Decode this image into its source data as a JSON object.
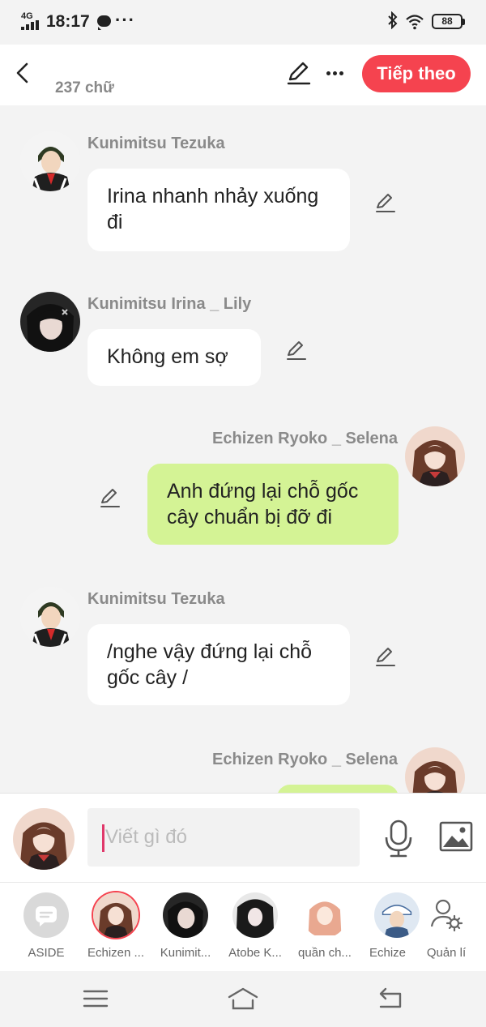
{
  "status_bar": {
    "network": "4G",
    "time": "18:17",
    "battery": "88"
  },
  "header": {
    "word_count": "237 chữ",
    "next_label": "Tiếp theo"
  },
  "messages": [
    {
      "sender": "Kunimitsu Tezuka",
      "text": "Irina nhanh nhảy xuống đi",
      "side": "left"
    },
    {
      "sender": "Kunimitsu Irina _ Lily",
      "text": "Không em sợ",
      "side": "left"
    },
    {
      "sender": "Echizen Ryoko _ Selena",
      "text": "Anh đứng lại chỗ gốc cây chuẩn bị đỡ đi",
      "side": "right"
    },
    {
      "sender": "Kunimitsu Tezuka",
      "text": "/nghe vậy đứng lại chỗ gốc cây /",
      "side": "left"
    },
    {
      "sender": "Echizen Ryoko _ Selena",
      "text": "",
      "side": "right"
    }
  ],
  "composer": {
    "placeholder": "Viết gì đó"
  },
  "characters": [
    {
      "label": "ASIDE"
    },
    {
      "label": "Echizen ..."
    },
    {
      "label": "Kunimit..."
    },
    {
      "label": "Atobe K..."
    },
    {
      "label": "quần ch..."
    },
    {
      "label": "Echize"
    },
    {
      "label": "Quản lí"
    }
  ],
  "colors": {
    "accent": "#f5434f",
    "bubble_left": "#ffffff",
    "bubble_right": "#d4f395"
  }
}
